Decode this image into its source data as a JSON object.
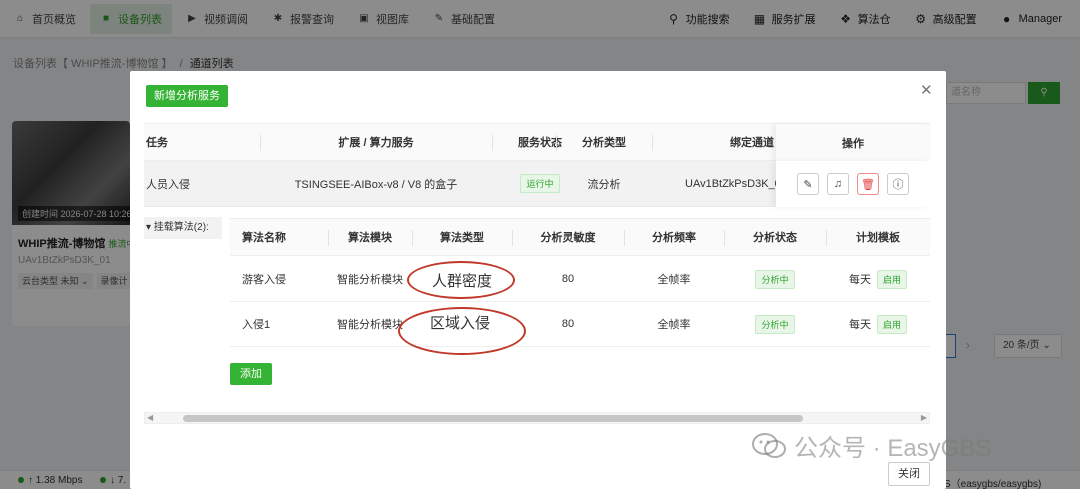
{
  "topnav": {
    "left": [
      {
        "icon": "home-icon",
        "label": "首页概览",
        "active": false
      },
      {
        "icon": "video-icon",
        "label": "设备列表",
        "active": true
      },
      {
        "icon": "play-icon",
        "label": "视频调阅",
        "active": false
      },
      {
        "icon": "alarm-icon",
        "label": "报警查询",
        "active": false
      },
      {
        "icon": "image-icon",
        "label": "视图库",
        "active": false
      },
      {
        "icon": "edit-icon",
        "label": "基础配置",
        "active": false
      }
    ],
    "right": [
      {
        "icon": "search-icon",
        "label": "功能搜索"
      },
      {
        "icon": "grid-icon",
        "label": "服务扩展"
      },
      {
        "icon": "dropbox-icon",
        "label": "算法仓"
      },
      {
        "icon": "gear-icon",
        "label": "高级配置"
      },
      {
        "icon": "user-icon",
        "label": "Manager"
      }
    ]
  },
  "breadcrumb": {
    "parent": "设备列表【 WHIP推流-博物馆 】",
    "sep": "/",
    "current": "通道列表"
  },
  "bg": {
    "search_placeholder": "道名称",
    "card": {
      "time_label": "创建时间 2026-07-28 10:26:4",
      "title": "WHIP推流-博物馆",
      "status": "推流中",
      "sub": "UAv1BtZkPsD3K_01",
      "ptz": "云台类型 未知 ⌄",
      "record": "录像计"
    },
    "pager_size": "20 条/页 ⌄",
    "status": {
      "up": "↑ 1.38 Mbps",
      "down": "↓ 7.",
      "right": "S（easygbs/easygbs)"
    }
  },
  "modal": {
    "new_button": "新增分析服务",
    "outer_table": {
      "headers": [
        "任务",
        "扩展 / 算力服务",
        "服务状态",
        "分析类型",
        "绑定通道",
        "操作"
      ],
      "row": {
        "task": "人员入侵",
        "service": "TSINGSEE-AIBox-v8 / V8 的盒子",
        "status": "运行中",
        "type": "流分析",
        "channel": "UAv1BtZkPsD3K_0"
      }
    },
    "expand_label": "▾ 挂载算法(2):",
    "inner_table": {
      "headers": [
        "算法名称",
        "算法模块",
        "算法类型",
        "分析灵敏度",
        "分析频率",
        "分析状态",
        "计划模板"
      ],
      "rows": [
        {
          "name": "游客入侵",
          "module": "智能分析模块",
          "sensitivity": "80",
          "freq": "全帧率",
          "status": "分析中",
          "plan": "每天",
          "plan_tag": "启用"
        },
        {
          "name": "入侵1",
          "module": "智能分析模块",
          "sensitivity": "80",
          "freq": "全帧率",
          "status": "分析中",
          "plan": "每天",
          "plan_tag": "启用"
        }
      ]
    },
    "add_button": "添加",
    "close_button": "关闭",
    "annotations": [
      "人群密度",
      "区域入侵"
    ]
  },
  "watermark": "公众号 · EasyGBS"
}
